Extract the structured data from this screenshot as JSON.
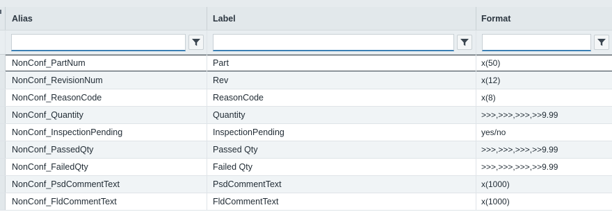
{
  "columns": {
    "alias": "Alias",
    "label": "Label",
    "format": "Format"
  },
  "filters": {
    "alias": "",
    "label": "",
    "format": ""
  },
  "rows": [
    {
      "alias": "NonConf_PartNum",
      "label": "Part",
      "format": "x(50)"
    },
    {
      "alias": "NonConf_RevisionNum",
      "label": "Rev",
      "format": "x(12)"
    },
    {
      "alias": "NonConf_ReasonCode",
      "label": "ReasonCode",
      "format": "x(8)"
    },
    {
      "alias": "NonConf_Quantity",
      "label": "Quantity",
      "format": ">>>,>>>,>>>,>>9.99"
    },
    {
      "alias": "NonConf_InspectionPending",
      "label": "InspectionPending",
      "format": "yes/no"
    },
    {
      "alias": "NonConf_PassedQty",
      "label": "Passed Qty",
      "format": ">>>,>>>,>>>,>>9.99"
    },
    {
      "alias": "NonConf_FailedQty",
      "label": "Failed Qty",
      "format": ">>>,>>>,>>>,>>9.99"
    },
    {
      "alias": "NonConf_PsdCommentText",
      "label": "PsdCommentText",
      "format": "x(1000)"
    },
    {
      "alias": "NonConf_FldCommentText",
      "label": "FldCommentText",
      "format": "x(1000)"
    }
  ],
  "icons": {
    "filter": "filter-funnel-icon"
  },
  "colors": {
    "header_bg": "#e2e8eb",
    "input_underline": "#3b7fb4",
    "alt_row": "#f0f4f6"
  }
}
